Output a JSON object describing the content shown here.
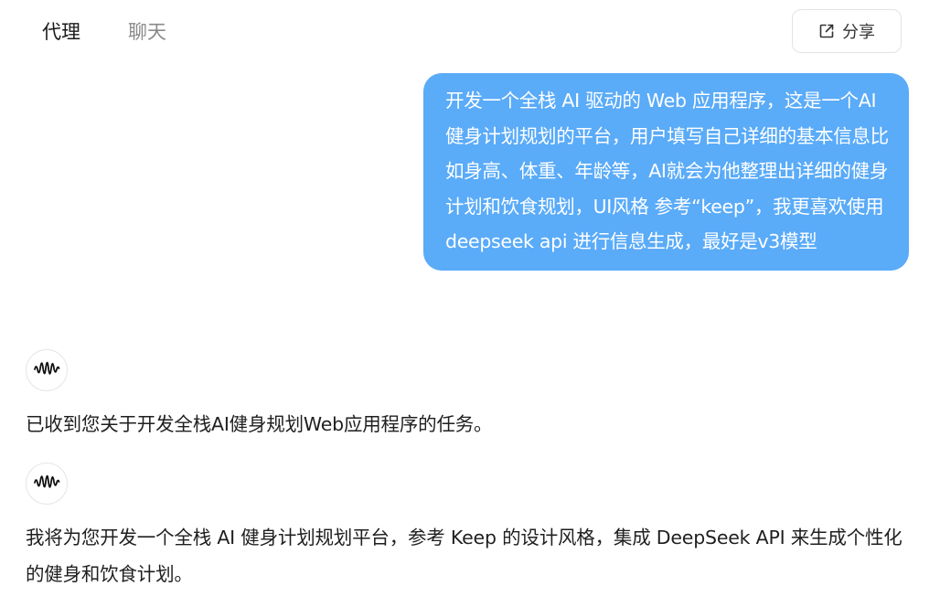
{
  "tabs": [
    {
      "label": "代理",
      "active": true
    },
    {
      "label": "聊天",
      "active": false
    }
  ],
  "share": {
    "label": "分享",
    "icon": "share-icon"
  },
  "user_message": {
    "text": "开发一个全栈 AI 驱动的 Web 应用程序，这是一个AI健身计划规划的平台，用户填写自己详细的基本信息比如身高、体重、年龄等，AI就会为他整理出详细的健身计划和饮食规划，UI风格 参考“keep”，我更喜欢使用 deepseek api 进行信息生成，最好是v3模型",
    "bubble_color": "#5aabf8"
  },
  "assistant_messages": [
    {
      "avatar_icon": "waveform-icon",
      "text": "已收到您关于开发全栈AI健身规划Web应用程序的任务。"
    },
    {
      "avatar_icon": "waveform-icon",
      "text": "我将为您开发一个全栈 AI 健身计划规划平台，参考 Keep 的设计风格，集成 DeepSeek API 来生成个性化的健身和饮食计划。"
    }
  ]
}
